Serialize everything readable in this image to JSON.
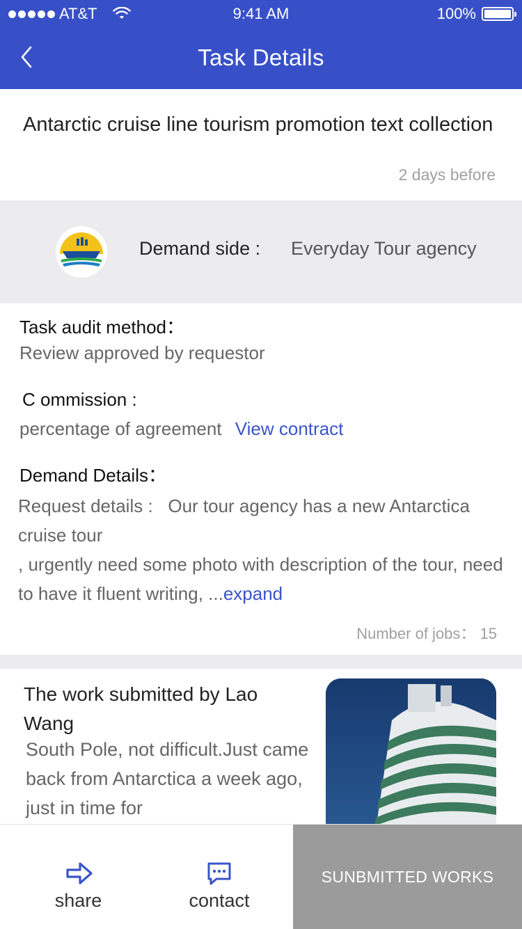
{
  "status_bar": {
    "carrier": "AT&T",
    "time": "9:41 AM",
    "battery": "100%"
  },
  "nav": {
    "title": "Task Details",
    "back_icon": "chevron-left-icon"
  },
  "task": {
    "title": "Antarctic cruise line tourism promotion text collection",
    "posted": "2 days before"
  },
  "demand_side": {
    "label": "Demand side :",
    "value": "Everyday Tour agency"
  },
  "details": {
    "audit_label": "Task audit method：",
    "audit_value": "Review approved by requestor",
    "commission_label": "C ommission :",
    "commission_value": "percentage of agreement",
    "view_contract": "View contract",
    "demand_details_label": "Demand Details：",
    "request_prefix": "Request details :",
    "request_text": "Our tour agency has a new Antarctica cruise tour",
    "request_text_2": ", urgently need some photo with description of the tour, need to have it fluent writing, ...",
    "expand": "expand",
    "jobs": "Number of jobs： 15"
  },
  "submitted_work": {
    "title": "The work submitted by Lao Wang",
    "text": "South Pole, not difficult.Just came back from Antarctica a week ago, just in time for"
  },
  "bottom_bar": {
    "share": "share",
    "contact": "contact",
    "submit": "SUNBMITTED WORKS"
  },
  "colors": {
    "primary": "#3850c7",
    "link": "#3a55c9",
    "submit_bg": "#9b9b9b"
  }
}
